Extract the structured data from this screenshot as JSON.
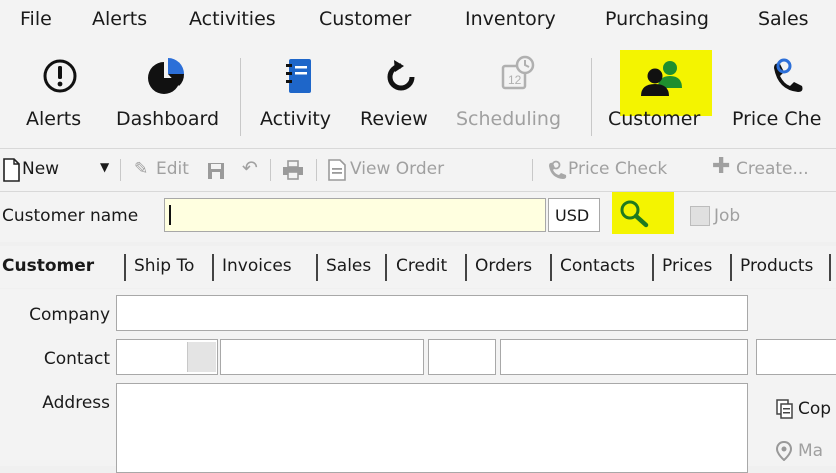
{
  "menu": [
    "File",
    "Alerts",
    "Activities",
    "Customer",
    "Inventory",
    "Purchasing",
    "Sales"
  ],
  "toolbar_big": [
    {
      "label": "Alerts",
      "icon": "alert-icon",
      "enabled": true
    },
    {
      "label": "Dashboard",
      "icon": "pie-chart-icon",
      "enabled": true
    },
    {
      "label": "Activity",
      "icon": "notebook-icon",
      "enabled": true
    },
    {
      "label": "Review",
      "icon": "refresh-icon",
      "enabled": true
    },
    {
      "label": "Scheduling",
      "icon": "calendar-clock-icon",
      "enabled": false
    },
    {
      "label": "Customer",
      "icon": "users-icon",
      "enabled": true,
      "highlighted": true
    },
    {
      "label": "Price Che",
      "icon": "phone-icon",
      "enabled": true
    }
  ],
  "toolbar_small": {
    "new": "New",
    "edit": "Edit",
    "view_order": "View Order",
    "price_check": "Price Check",
    "create": "Create..."
  },
  "search": {
    "label": "Customer name",
    "value": "",
    "currency": "USD",
    "job_label": "Job",
    "job_checked": false
  },
  "tabs": [
    "Customer",
    "Ship To",
    "Invoices",
    "Sales",
    "Credit",
    "Orders",
    "Contacts",
    "Prices",
    "Products"
  ],
  "active_tab": "Customer",
  "form": {
    "company_label": "Company",
    "contact_label": "Contact",
    "address_label": "Address",
    "copy_label": "Cop",
    "map_label": "Ma"
  },
  "colors": {
    "highlight": "#f4f400",
    "field_bg": "#ffffe0",
    "customer_icon": "#1f8f2e",
    "price_icon": "#2c6fd8"
  }
}
